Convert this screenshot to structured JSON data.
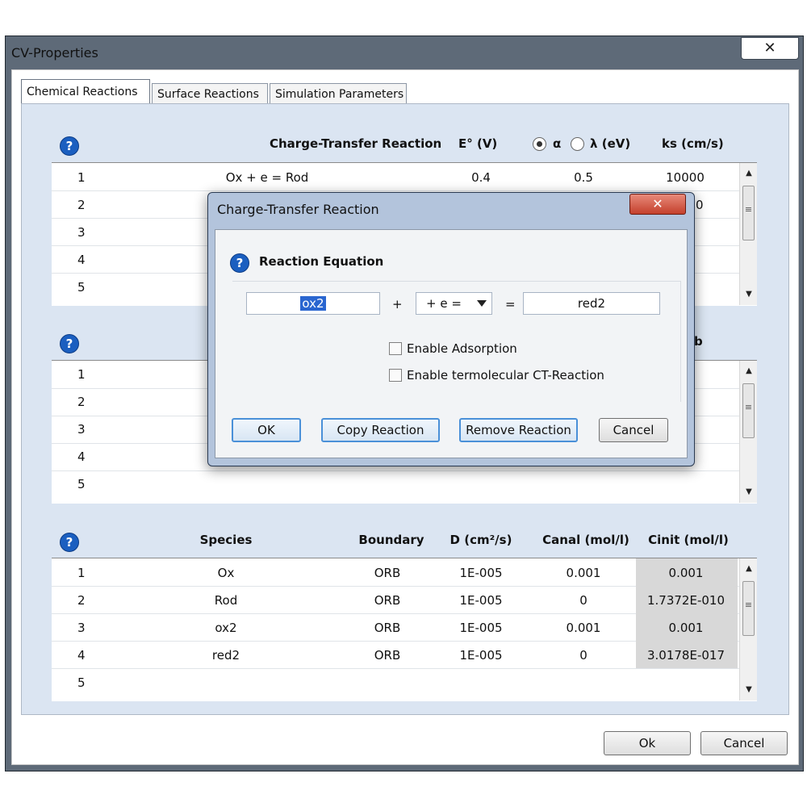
{
  "window": {
    "title": "CV-Properties",
    "close_glyph": "✕"
  },
  "tabs": [
    {
      "label": "Chemical Reactions",
      "active": true
    },
    {
      "label": "Surface Reactions",
      "active": false
    },
    {
      "label": "Simulation Parameters",
      "active": false
    }
  ],
  "ct_section": {
    "help_glyph": "?",
    "headers": {
      "reaction": "Charge-Transfer Reaction",
      "e0": "E° (V)",
      "alpha": "α",
      "lambda": "λ (eV)",
      "ks": "ks (cm/s)"
    },
    "radio": {
      "alpha_selected": true
    },
    "rows": [
      {
        "n": "1",
        "reaction": "Ox + e = Rod",
        "e0": "0.4",
        "alpha": "0.5",
        "ks": "10000"
      },
      {
        "n": "2",
        "ks": "0"
      },
      {
        "n": "3"
      },
      {
        "n": "4"
      },
      {
        "n": "5"
      }
    ]
  },
  "chem_section": {
    "help_glyph": "?",
    "header_fragment": "b",
    "rows": [
      {
        "n": "1"
      },
      {
        "n": "2"
      },
      {
        "n": "3"
      },
      {
        "n": "4"
      },
      {
        "n": "5"
      }
    ]
  },
  "species_section": {
    "help_glyph": "?",
    "headers": {
      "species": "Species",
      "boundary": "Boundary",
      "d": "D (cm²/s)",
      "canal": "Canal (mol/l)",
      "cinit": "Cinit (mol/l)"
    },
    "rows": [
      {
        "n": "1",
        "species": "Ox",
        "boundary": "ORB",
        "d": "1E-005",
        "canal": "0.001",
        "cinit": "0.001"
      },
      {
        "n": "2",
        "species": "Rod",
        "boundary": "ORB",
        "d": "1E-005",
        "canal": "0",
        "cinit": "1.7372E-010"
      },
      {
        "n": "3",
        "species": "ox2",
        "boundary": "ORB",
        "d": "1E-005",
        "canal": "0.001",
        "cinit": "0.001"
      },
      {
        "n": "4",
        "species": "red2",
        "boundary": "ORB",
        "d": "1E-005",
        "canal": "0",
        "cinit": "3.0178E-017"
      },
      {
        "n": "5"
      }
    ]
  },
  "footer": {
    "ok": "Ok",
    "cancel": "Cancel"
  },
  "modal": {
    "title": "Charge-Transfer Reaction",
    "close_glyph": "✕",
    "help_glyph": "?",
    "section_label": "Reaction Equation",
    "oxidant": "ox2",
    "plus": "+",
    "electrons": "+ e =",
    "equals": "=",
    "reductant": "red2",
    "enable_adsorption": "Enable Adsorption",
    "enable_termolecular": "Enable termolecular CT-Reaction",
    "buttons": {
      "ok": "OK",
      "copy": "Copy Reaction",
      "remove": "Remove Reaction",
      "cancel": "Cancel"
    }
  },
  "scroll": {
    "up": "▲",
    "down": "▼",
    "grip": "≡"
  }
}
